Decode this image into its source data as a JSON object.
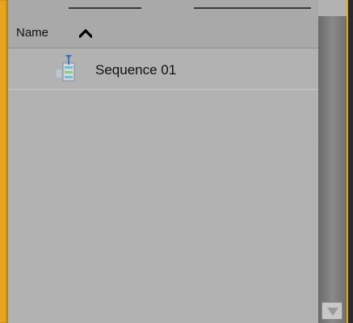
{
  "header": {
    "name_label": "Name",
    "sort_icon": "chevron-up-icon"
  },
  "items": [
    {
      "label": "Sequence 01",
      "icon": "sequence-icon"
    }
  ],
  "colors": {
    "accent": "#e6a41f",
    "panel": "#b2b2b2",
    "header": "#a9a9a9"
  }
}
